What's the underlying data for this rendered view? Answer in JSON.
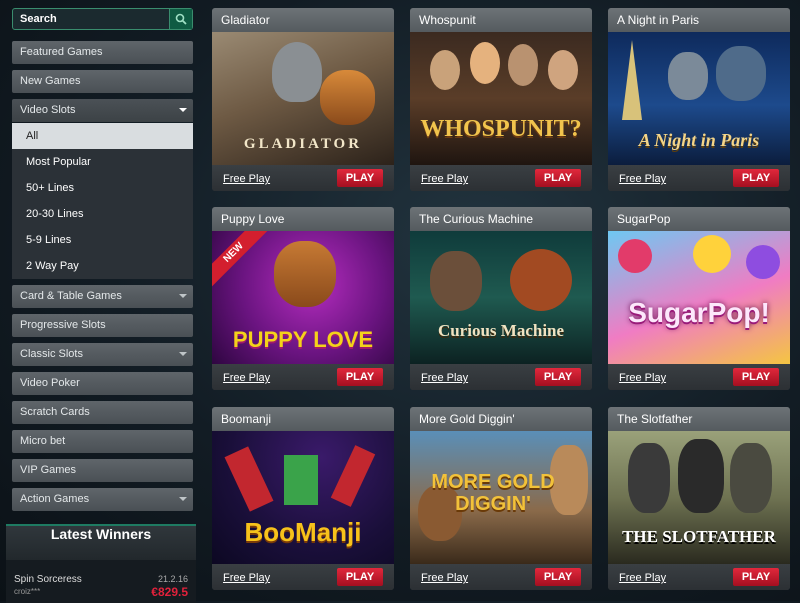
{
  "search": {
    "placeholder": "Search"
  },
  "nav": {
    "featured": "Featured Games",
    "new": "New Games",
    "video_slots": "Video Slots",
    "sub": [
      "All",
      "Most Popular",
      "50+ Lines",
      "20-30 Lines",
      "5-9 Lines",
      "2 Way Pay"
    ],
    "card_table": "Card & Table Games",
    "progressive": "Progressive Slots",
    "classic": "Classic Slots",
    "video_poker": "Video Poker",
    "scratch": "Scratch Cards",
    "micro": "Micro bet",
    "vip": "VIP Games",
    "action": "Action Games"
  },
  "winners": {
    "title": "Latest Winners",
    "game": "Spin Sorceress",
    "date": "21.2.16",
    "user": "croiz***",
    "amount": "€829.5"
  },
  "tiles": [
    {
      "title": "Gladiator",
      "logo": "GLADIATOR"
    },
    {
      "title": "Whospunit",
      "logo": "WHOSPUNIT?"
    },
    {
      "title": "A Night in Paris",
      "logo": "A Night in Paris"
    },
    {
      "title": "Puppy Love",
      "logo": "PUPPY LOVE",
      "badge": "NEW"
    },
    {
      "title": "The Curious Machine",
      "logo": "Curious Machine"
    },
    {
      "title": "SugarPop",
      "logo": "SugarPop!"
    },
    {
      "title": "Boomanji",
      "logo": "BooManji"
    },
    {
      "title": "More Gold Diggin'",
      "logo": "MORE GOLD DIGGIN'"
    },
    {
      "title": "The Slotfather",
      "logo": "THE SLOTFATHER"
    }
  ],
  "labels": {
    "free_play": "Free Play",
    "play": "PLAY"
  },
  "colors": {
    "accent_green": "#1e7b62",
    "play_red": "#d31f2e",
    "winner_amount": "#e2213b"
  }
}
